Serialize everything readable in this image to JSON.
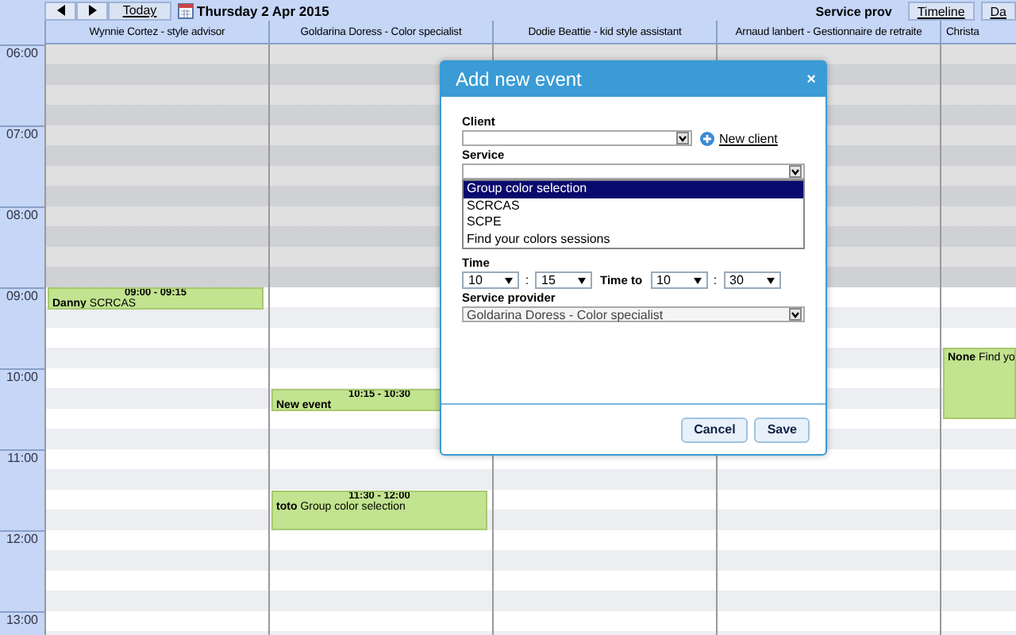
{
  "toolbar": {
    "today": "Today",
    "date": "Thursday 2 Apr 2015",
    "view_tabs": [
      {
        "label": "Service prov",
        "selected": true
      },
      {
        "label": "Timeline",
        "selected": false
      },
      {
        "label": "Da",
        "selected": false
      }
    ]
  },
  "hours": [
    "06:00",
    "07:00",
    "08:00",
    "09:00",
    "10:00",
    "11:00",
    "12:00",
    "13:00"
  ],
  "columns": [
    {
      "header": "Wynnie Cortez - style advisor",
      "events": [
        {
          "time_label": "09:00 - 09:15",
          "client": "Danny",
          "service": "SCRCAS"
        }
      ]
    },
    {
      "header": "Goldarina Doress - Color specialist",
      "events": [
        {
          "time_label": "10:15 - 10:30",
          "client": "New event"
        },
        {
          "time_label": "11:30 - 12:00",
          "client": "toto",
          "service": "Group color selection"
        }
      ]
    },
    {
      "header": "Dodie Beattie - kid style assistant"
    },
    {
      "header": "Arnaud lanbert - Gestionnaire de retraite"
    },
    {
      "header": "Christa",
      "events": [
        {
          "client": "None",
          "service": "Find yo"
        }
      ]
    }
  ],
  "dialog": {
    "title": "Add new event",
    "close": "×",
    "client": {
      "label": "Client",
      "new_client": "New client"
    },
    "service": {
      "label": "Service",
      "options": [
        {
          "label": "Group color selection",
          "selected": true
        },
        {
          "label": "SCRCAS",
          "selected": false
        },
        {
          "label": "SCPE",
          "selected": false
        },
        {
          "label": "Find your colors sessions",
          "selected": false
        }
      ]
    },
    "time": {
      "label": "Time",
      "from_hour": "10",
      "from_sep": ":",
      "from_minute": "15",
      "to_label": "Time to",
      "to_hour": "10",
      "to_sep": ":",
      "to_minute": "30"
    },
    "provider": {
      "label": "Service provider",
      "value": "Goldarina Doress - Color specialist"
    },
    "buttons": [
      "Cancel",
      "Save"
    ]
  }
}
